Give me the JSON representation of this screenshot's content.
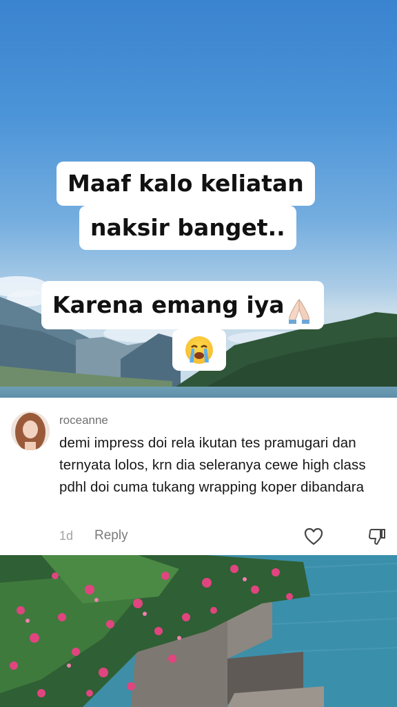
{
  "captions": {
    "line1": "Maaf kalo keliatan",
    "line2": "naksir banget..",
    "line3": "Karena emang iya"
  },
  "icons": {
    "pray": "folded-hands-icon",
    "cry": "loudly-crying-face-icon",
    "like": "heart-outline-icon",
    "dislike": "thumbs-down-icon"
  },
  "comment": {
    "username": "roceanne",
    "text": "demi impress doi rela ikutan tes pramugari dan ternyata lolos, krn dia seleranya cewe high class pdhl doi cuma tukang wrapping koper dibandara",
    "time": "1d",
    "reply_label": "Reply"
  },
  "colors": {
    "sky": "#4d95d8",
    "lake": "#3a8aa6",
    "flowers": "#e0457f"
  }
}
